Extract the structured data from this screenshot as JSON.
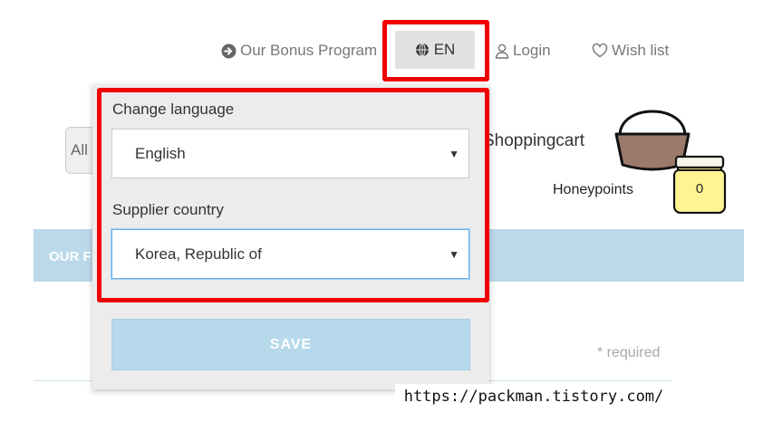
{
  "topnav": {
    "bonus_label": "Our Bonus Program",
    "language_label": "EN",
    "login_label": "Login",
    "wishlist_label": "Wish list"
  },
  "search": {
    "category_label": "All"
  },
  "cart": {
    "label": "Shoppingcart",
    "honeypoints_label": "Honeypoints",
    "honeypoints_value": "0"
  },
  "promo": {
    "label": "OUR F"
  },
  "language_dropdown": {
    "language_field_label": "Change language",
    "language_value": "English",
    "country_field_label": "Supplier country",
    "country_value": "Korea, Republic of",
    "save_label": "SAVE"
  },
  "form": {
    "required_note": "* required"
  },
  "watermark": "https://packman.tistory.com/",
  "colors": {
    "highlight": "#f10000",
    "promo_band": "#bcd9ea",
    "save_button": "#b6d9ec",
    "dropdown_bg": "#ececec"
  },
  "icons": [
    "arrow-circle-right-icon",
    "globe-icon",
    "user-icon",
    "heart-icon",
    "basket-icon",
    "honey-jar-icon",
    "caret-down-icon"
  ]
}
